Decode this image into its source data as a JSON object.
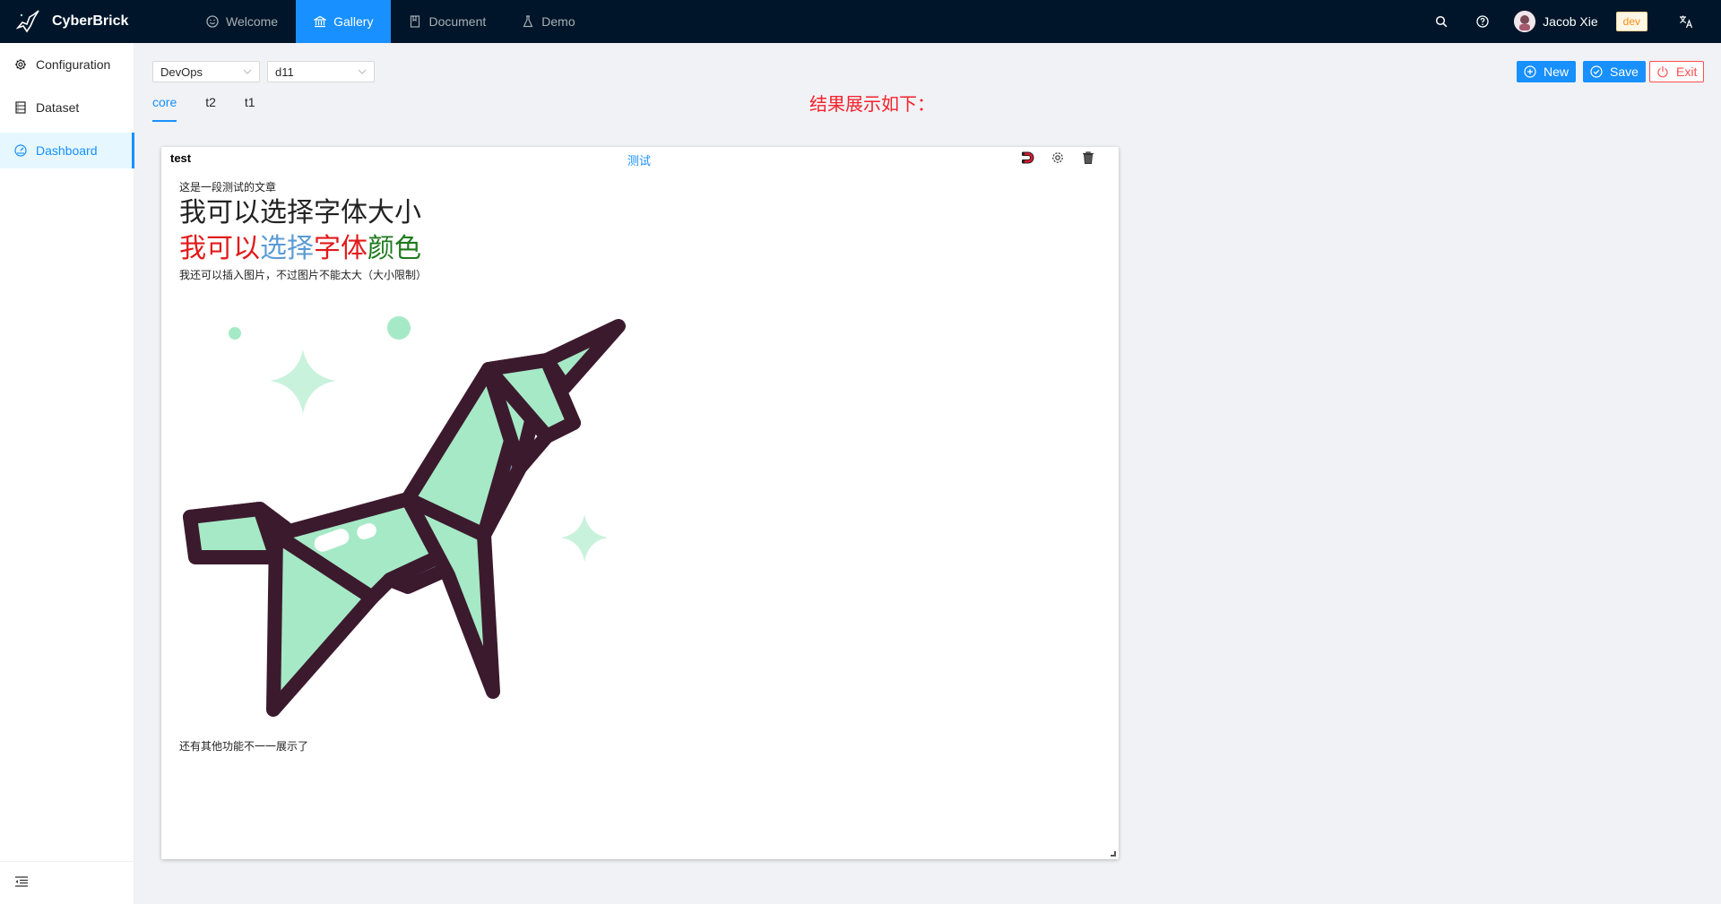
{
  "header": {
    "brand": "CyberBrick",
    "nav": [
      {
        "label": "Welcome",
        "icon": "smile-icon"
      },
      {
        "label": "Gallery",
        "icon": "bank-icon"
      },
      {
        "label": "Document",
        "icon": "book-icon"
      },
      {
        "label": "Demo",
        "icon": "experiment-icon"
      }
    ],
    "user_name": "Jacob Xie",
    "env_tag": "dev"
  },
  "sidebar": {
    "items": [
      {
        "label": "Configuration",
        "icon": "gear-icon"
      },
      {
        "label": "Dataset",
        "icon": "database-icon"
      },
      {
        "label": "Dashboard",
        "icon": "dashboard-icon"
      }
    ]
  },
  "toolbar": {
    "category_select": "DevOps",
    "dashboard_select": "d11",
    "tabs": [
      "core",
      "t2",
      "t1"
    ],
    "note": "结果展示如下：",
    "new_label": "New",
    "save_label": "Save",
    "exit_label": "Exit"
  },
  "card": {
    "title": "test",
    "subtitle": "测试",
    "line1": "这是一段测试的文章",
    "line2": "我可以选择字体大小",
    "line3_red": "我可以",
    "line3_blue": "选择",
    "line3_red2": "字体",
    "line3_green": "颜色",
    "line4": "我还可以插入图片，不过图片不能太大（大小限制）",
    "line5": "还有其他功能不一一展示了"
  },
  "colors": {
    "header_bg": "#001529",
    "primary": "#1890ff",
    "danger": "#ff4d4f"
  }
}
